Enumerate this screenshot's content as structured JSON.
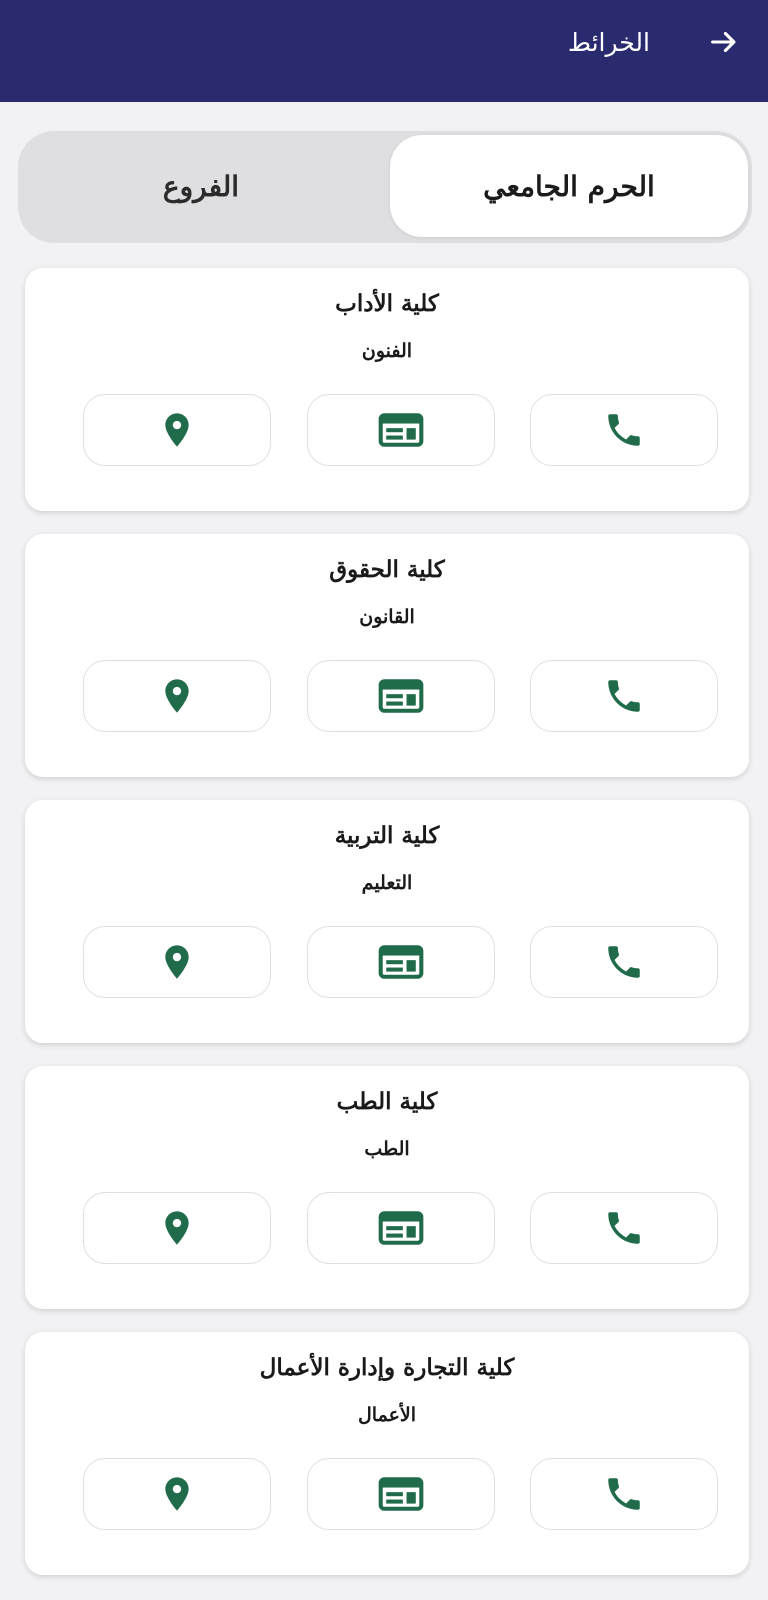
{
  "app_bar": {
    "title": "الخرائط",
    "back_icon": "arrow-right-icon",
    "background": "#2a2b6e"
  },
  "tabs": [
    {
      "label": "الحرم الجامعي",
      "active": true
    },
    {
      "label": "الفروع",
      "active": false
    }
  ],
  "accent_color": "#1f6b4a",
  "colleges": [
    {
      "title": "كلية الأداب",
      "subtitle": "الفنون"
    },
    {
      "title": "كلية الحقوق",
      "subtitle": "القانون"
    },
    {
      "title": "كلية التربية",
      "subtitle": "التعليم"
    },
    {
      "title": "كلية الطب",
      "subtitle": "الطب"
    },
    {
      "title": "كلية التجارة وإدارة الأعمال",
      "subtitle": "الأعمال"
    }
  ],
  "card_actions": [
    {
      "name": "phone",
      "icon": "phone-icon"
    },
    {
      "name": "info",
      "icon": "card-icon"
    },
    {
      "name": "location",
      "icon": "map-pin-icon"
    }
  ]
}
